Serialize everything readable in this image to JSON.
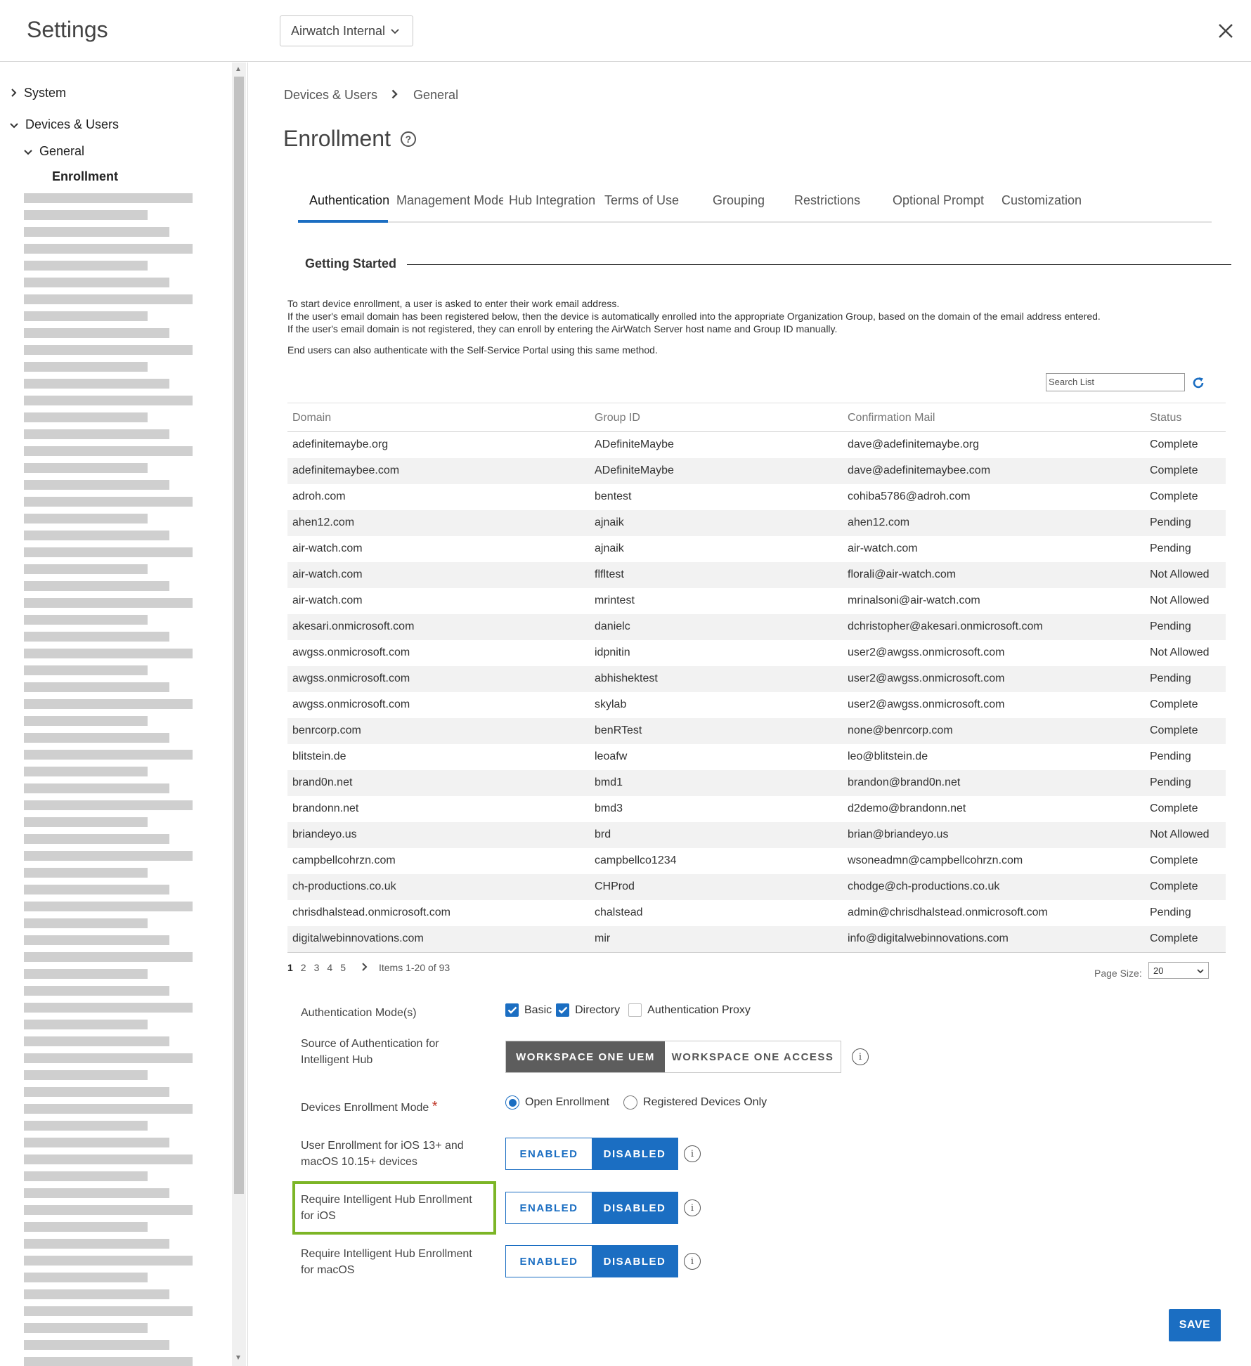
{
  "header": {
    "title": "Settings",
    "org_selector": "Airwatch Internal"
  },
  "sidebar": {
    "system": "System",
    "devices_users": "Devices & Users",
    "general": "General",
    "enrollment": "Enrollment"
  },
  "breadcrumb": {
    "parent": "Devices & Users",
    "current": "General"
  },
  "page": {
    "title": "Enrollment"
  },
  "tabs": [
    "Authentication",
    "Management Mode",
    "Hub Integration",
    "Terms of Use",
    "Grouping",
    "Restrictions",
    "Optional Prompt",
    "Customization"
  ],
  "getting_started": {
    "heading": "Getting Started",
    "line1": "To start device enrollment, a user is asked to enter their work email address.",
    "line2": "If the user's email domain has been registered below, then the device is automatically enrolled into the appropriate Organization Group, based on the domain of the email address entered.",
    "line3": "If the user's email domain is not registered, they can enroll by entering the AirWatch Server host name and Group ID manually.",
    "line4": "End users can also authenticate with the Self-Service Portal using this same method."
  },
  "search": {
    "placeholder": "Search List"
  },
  "table": {
    "headers": [
      "Domain",
      "Group ID",
      "Confirmation Mail",
      "Status"
    ],
    "rows": [
      [
        "adefinitemaybe.org",
        "ADefiniteMaybe",
        "dave@adefinitemaybe.org",
        "Complete"
      ],
      [
        "adefinitemaybee.com",
        "ADefiniteMaybe",
        "dave@adefinitemaybee.com",
        "Complete"
      ],
      [
        "adroh.com",
        "bentest",
        "cohiba5786@adroh.com",
        "Complete"
      ],
      [
        "ahen12.com",
        "ajnaik",
        "ahen12.com",
        "Pending"
      ],
      [
        "air-watch.com",
        "ajnaik",
        "air-watch.com",
        "Pending"
      ],
      [
        "air-watch.com",
        "flfltest",
        "florali@air-watch.com",
        "Not Allowed"
      ],
      [
        "air-watch.com",
        "mrintest",
        "mrinalsoni@air-watch.com",
        "Not Allowed"
      ],
      [
        "akesari.onmicrosoft.com",
        "danielc",
        "dchristopher@akesari.onmicrosoft.com",
        "Pending"
      ],
      [
        "awgss.onmicrosoft.com",
        "idpnitin",
        "user2@awgss.onmicrosoft.com",
        "Not Allowed"
      ],
      [
        "awgss.onmicrosoft.com",
        "abhishektest",
        "user2@awgss.onmicrosoft.com",
        "Pending"
      ],
      [
        "awgss.onmicrosoft.com",
        "skylab",
        "user2@awgss.onmicrosoft.com",
        "Complete"
      ],
      [
        "benrcorp.com",
        "benRTest",
        "none@benrcorp.com",
        "Complete"
      ],
      [
        "blitstein.de",
        "leoafw",
        "leo@blitstein.de",
        "Pending"
      ],
      [
        "brand0n.net",
        "bmd1",
        "brandon@brand0n.net",
        "Pending"
      ],
      [
        "brandonn.net",
        "bmd3",
        "d2demo@brandonn.net",
        "Complete"
      ],
      [
        "briandeyo.us",
        "brd",
        "brian@briandeyo.us",
        "Not Allowed"
      ],
      [
        "campbellcohrzn.com",
        "campbellco1234",
        "wsoneadmn@campbellcohrzn.com",
        "Complete"
      ],
      [
        "ch-productions.co.uk",
        "CHProd",
        "chodge@ch-productions.co.uk",
        "Complete"
      ],
      [
        "chrisdhalstead.onmicrosoft.com",
        "chalstead",
        "admin@chrisdhalstead.onmicrosoft.com",
        "Pending"
      ],
      [
        "digitalwebinnovations.com",
        "mir",
        "info@digitalwebinnovations.com",
        "Complete"
      ]
    ]
  },
  "pager": {
    "pages": [
      "1",
      "2",
      "3",
      "4",
      "5"
    ],
    "items_text": "Items 1-20 of 93",
    "page_size_label": "Page Size:",
    "page_size": "20"
  },
  "form": {
    "auth_mode_label": "Authentication Mode(s)",
    "auth_basic": "Basic",
    "auth_directory": "Directory",
    "auth_proxy": "Authentication Proxy",
    "source_label_1": "Source of Authentication for",
    "source_label_2": "Intelligent Hub",
    "source_opt1": "WORKSPACE ONE UEM",
    "source_opt2": "WORKSPACE ONE ACCESS",
    "enroll_mode_label": "Devices Enrollment Mode",
    "enroll_open": "Open Enrollment",
    "enroll_registered": "Registered Devices Only",
    "user_enroll_label_1": "User Enrollment for iOS 13+ and",
    "user_enroll_label_2": "macOS 10.15+ devices",
    "hub_ios_label_1": "Require Intelligent Hub Enrollment",
    "hub_ios_label_2": "for iOS",
    "hub_macos_label_1": "Require Intelligent Hub Enrollment",
    "hub_macos_label_2": "for macOS",
    "enabled": "ENABLED",
    "disabled": "DISABLED",
    "required_mark": "*",
    "info_glyph": "i"
  },
  "save_label": "SAVE",
  "colors": {
    "accent": "#1b6ec2",
    "highlight": "#7cb526",
    "seg_dark": "#5d5d5d"
  }
}
